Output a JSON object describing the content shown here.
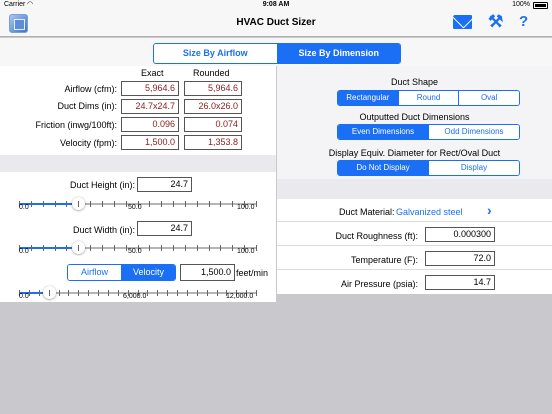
{
  "status": {
    "carrier": "Carrier",
    "time": "9:08 AM",
    "battery": "100%"
  },
  "nav": {
    "title": "HVAC Duct Sizer"
  },
  "mode": {
    "options": [
      "Size By Airflow",
      "Size By Dimension"
    ],
    "selected": 1
  },
  "results": {
    "col_exact": "Exact",
    "col_rounded": "Rounded",
    "rows": [
      {
        "label": "Airflow (cfm):",
        "exact": "5,964.6",
        "rounded": "5,964.6"
      },
      {
        "label": "Duct Dims (in):",
        "exact": "24.7x24.7",
        "rounded": "26.0x26.0"
      },
      {
        "label": "Friction (inwg/100ft):",
        "exact": "0.096",
        "rounded": "0.074"
      },
      {
        "label": "Velocity (fpm):",
        "exact": "1,500.0",
        "rounded": "1,353.8"
      }
    ]
  },
  "shape": {
    "title": "Duct Shape",
    "options": [
      "Rectangular",
      "Round",
      "Oval"
    ],
    "selected": 0
  },
  "outdims": {
    "title": "Outputted Duct Dimensions",
    "options": [
      "Even Dimensions",
      "Odd Dimensions"
    ],
    "selected": 0
  },
  "equiv": {
    "title": "Display Equiv. Diameter for Rect/Oval Duct",
    "options": [
      "Do Not Display",
      "Display"
    ],
    "selected": 0
  },
  "height": {
    "label": "Duct Height (in):",
    "value": "24.7",
    "slider": {
      "min": 0,
      "max": 100,
      "value": 24.7,
      "ticks": [
        "0.0",
        "50.0",
        "100.0"
      ]
    }
  },
  "width": {
    "label": "Duct Width (in):",
    "value": "24.7",
    "slider": {
      "min": 0,
      "max": 100,
      "value": 24.7,
      "ticks": [
        "0.0",
        "50.0",
        "100.0"
      ]
    }
  },
  "velocity": {
    "options": [
      "Airflow",
      "Velocity"
    ],
    "selected": 1,
    "value": "1,500.0",
    "unit": "feet/min",
    "slider": {
      "min": 0,
      "max": 12000,
      "value": 1500,
      "ticks": [
        "0.0",
        "6,000.0",
        "12,000.0"
      ]
    }
  },
  "props": {
    "material_label": "Duct Material:",
    "material_value": "Galvanized steel",
    "chevron": "chevron-right-icon",
    "roughness_label": "Duct Roughness (ft):",
    "roughness": "0.000300",
    "temp_label": "Temperature (F):",
    "temp": "72.0",
    "pressure_label": "Air Pressure (psia):",
    "pressure": "14.7"
  },
  "colors": {
    "accent": "#1a6ff5",
    "result_text": "#8b1c1c",
    "background": "#c8c8cd"
  }
}
